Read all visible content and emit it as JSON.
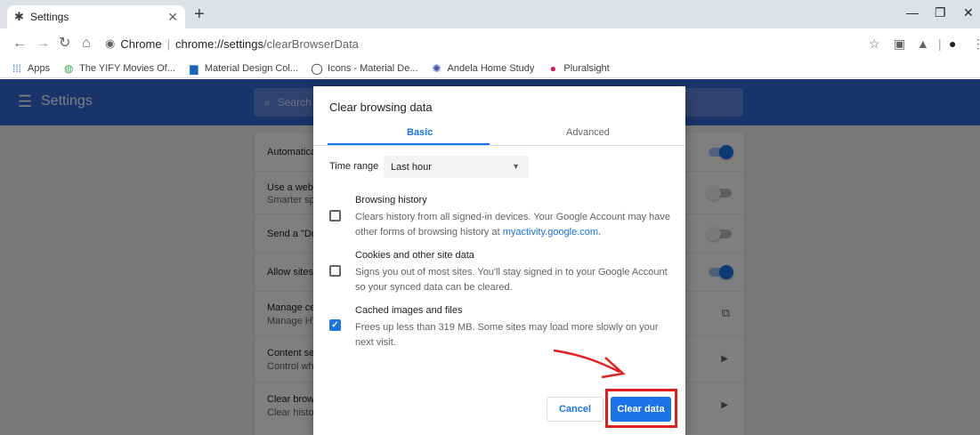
{
  "browser": {
    "tab": {
      "title": "Settings",
      "favicon": "gear-icon"
    },
    "url": {
      "chip": "Chrome",
      "host": "chrome://settings",
      "path": "/clearBrowserData"
    },
    "bookmarks": [
      {
        "label": "Apps",
        "icon": "apps-grid-icon",
        "color": "#1a73e8"
      },
      {
        "label": "The YIFY Movies Of...",
        "icon": "yify-icon",
        "color": "#34a853"
      },
      {
        "label": "Material Design Col...",
        "icon": "material-design-icon",
        "color": "#1565c0"
      },
      {
        "label": "Icons - Material De...",
        "icon": "github-icon",
        "color": "#202124"
      },
      {
        "label": "Andela Home Study",
        "icon": "andela-icon",
        "color": "#3f51b5"
      },
      {
        "label": "Pluralsight",
        "icon": "pluralsight-icon",
        "color": "#e0115f"
      }
    ]
  },
  "settings": {
    "title": "Settings",
    "search_placeholder": "Search",
    "rows": [
      {
        "title": "Automatica",
        "sub": "",
        "control": "toggle-on"
      },
      {
        "title": "Use a web",
        "sub": "Smarter sp",
        "control": "toggle-off"
      },
      {
        "title": "Send a \"Do",
        "sub": "",
        "control": "toggle-off"
      },
      {
        "title": "Allow sites",
        "sub": "",
        "control": "toggle-on"
      },
      {
        "title": "Manage ce",
        "sub": "Manage HT",
        "control": "external-link"
      },
      {
        "title": "Content se",
        "sub": "Control wh",
        "control": "chevron"
      },
      {
        "title": "Clear brow",
        "sub": "Clear histo",
        "control": "chevron"
      }
    ]
  },
  "dialog": {
    "title": "Clear browsing data",
    "tabs": {
      "basic": "Basic",
      "advanced": "Advanced",
      "active": "basic"
    },
    "time_range": {
      "label": "Time range",
      "value": "Last hour"
    },
    "options": [
      {
        "title": "Browsing history",
        "desc": "Clears history from all signed-in devices. Your Google Account may have other forms of browsing history at ",
        "link": "myactivity.google.com",
        "desc_end": ".",
        "checked": false
      },
      {
        "title": "Cookies and other site data",
        "desc": "Signs you out of most sites. You'll stay signed in to your Google Account so your synced data can be cleared.",
        "checked": false
      },
      {
        "title": "Cached images and files",
        "desc": "Frees up less than 319 MB. Some sites may load more slowly on your next visit.",
        "checked": true
      }
    ],
    "buttons": {
      "cancel": "Cancel",
      "clear": "Clear data"
    }
  },
  "colors": {
    "settings_header": "#3367d6",
    "accent": "#1a73e8",
    "annotation": "#e02020"
  }
}
